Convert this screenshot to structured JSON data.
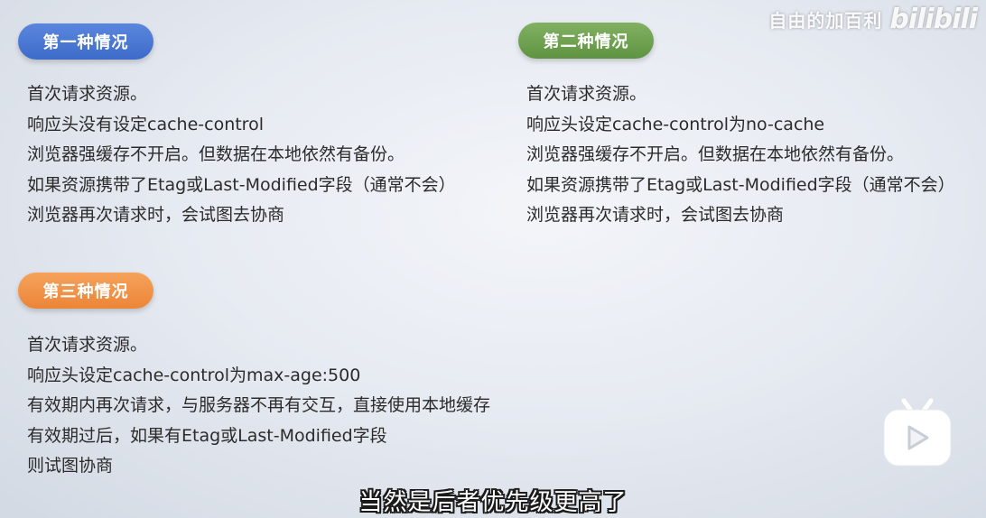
{
  "case1": {
    "label": "第一种情况",
    "color": "#4a78d4",
    "lines": [
      "首次请求资源。",
      "响应头没有设定cache-control",
      "浏览器强缓存不开启。但数据在本地依然有备份。",
      "如果资源携带了Etag或Last-Modified字段（通常不会）",
      "浏览器再次请求时，会试图去协商"
    ]
  },
  "case2": {
    "label": "第二种情况",
    "color": "#6fa34f",
    "lines": [
      "首次请求资源。",
      "响应头设定cache-control为no-cache",
      "浏览器强缓存不开启。但数据在本地依然有备份。",
      "如果资源携带了Etag或Last-Modified字段（通常不会）",
      "浏览器再次请求时，会试图去协商"
    ]
  },
  "case3": {
    "label": "第三种情况",
    "color": "#f08f45",
    "lines": [
      "首次请求资源。",
      "响应头设定cache-control为max-age:500",
      "有效期内再次请求，与服务器不再有交互，直接使用本地缓存",
      "有效期过后，如果有Etag或Last-Modified字段",
      "则试图协商"
    ]
  },
  "watermark": {
    "text": "自由的加百利",
    "logo": "bilibili"
  },
  "subtitle": "当然是后者优先级更高了"
}
